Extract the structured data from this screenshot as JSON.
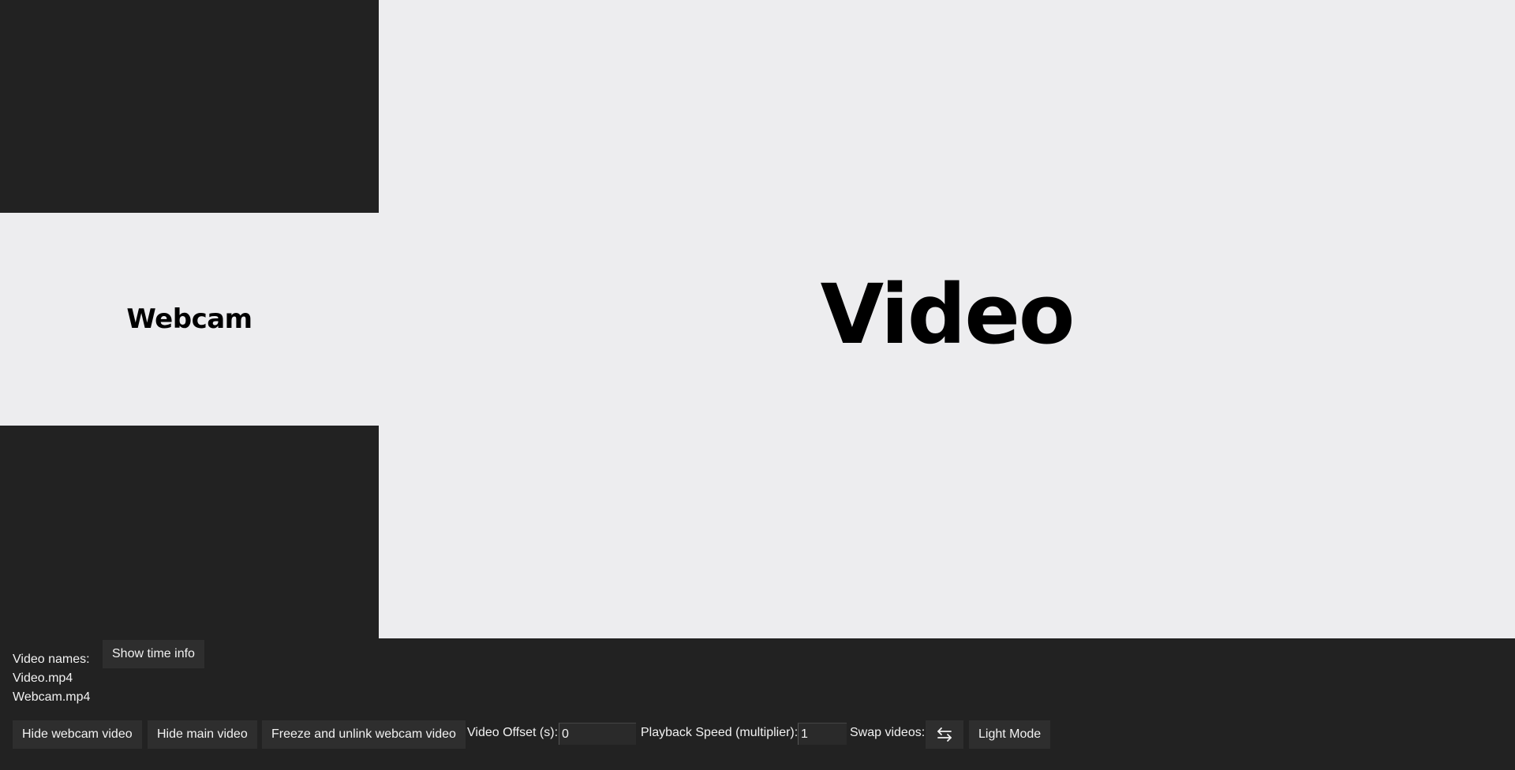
{
  "webcam": {
    "label": "Webcam"
  },
  "main_video": {
    "label": "Video"
  },
  "video_names": {
    "heading": "Video names:",
    "main_file": "Video.mp4",
    "webcam_file": "Webcam.mp4"
  },
  "buttons": {
    "show_time_info": "Show time info",
    "hide_webcam": "Hide webcam video",
    "hide_main": "Hide main video",
    "freeze_unlink": "Freeze and unlink webcam video",
    "light_mode": "Light Mode"
  },
  "offset": {
    "label": "Video Offset (s):",
    "value": "0"
  },
  "speed": {
    "label": "Playback Speed (multiplier):",
    "value": "1"
  },
  "swap": {
    "label": "Swap videos:",
    "icon": "swap-arrows-icon"
  },
  "colors": {
    "background": "#222222",
    "video_surface": "#ededef",
    "button": "#2e2e2e",
    "text": "#f2f2f2"
  }
}
